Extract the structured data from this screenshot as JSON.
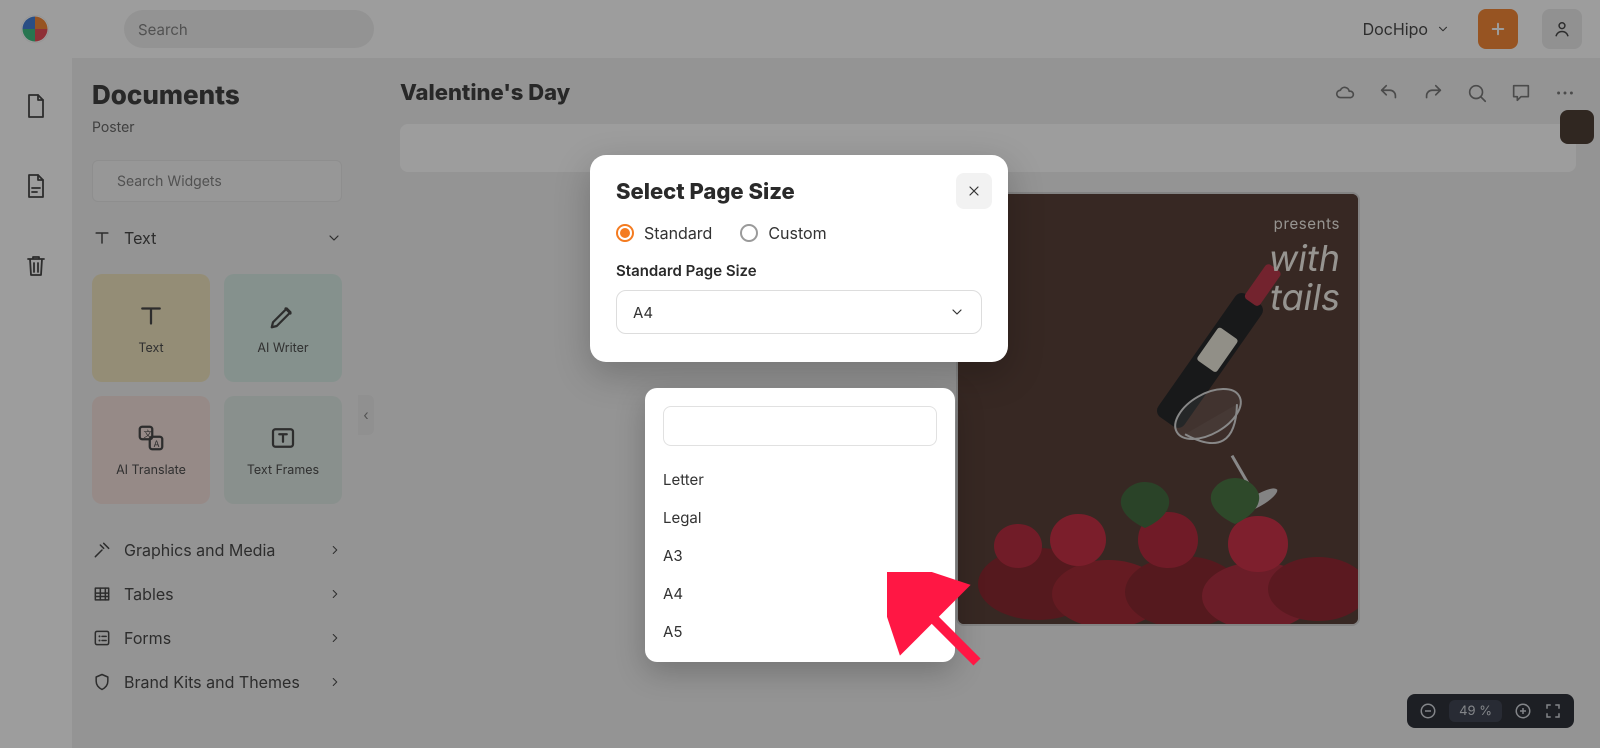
{
  "topbar": {
    "search_placeholder": "Search",
    "workspace": "DocHipo"
  },
  "sidebar": {
    "title": "Documents",
    "subtitle": "Poster",
    "search_widgets_placeholder": "Search Widgets",
    "group_text": "Text",
    "cards": {
      "text": "Text",
      "ai_writer": "AI Writer",
      "ai_translate": "AI Translate",
      "text_frames": "Text Frames"
    },
    "menu": {
      "graphics": "Graphics and Media",
      "tables": "Tables",
      "forms": "Forms",
      "brand": "Brand Kits and Themes"
    }
  },
  "canvas": {
    "title": "Valentine's Day",
    "zoom": "49 %"
  },
  "poster": {
    "presents": "presents",
    "line1": "with",
    "line2": "tails"
  },
  "modal": {
    "title": "Select Page Size",
    "radio_standard": "Standard",
    "radio_custom": "Custom",
    "label_standard": "Standard Page Size",
    "selected_value": "A4"
  },
  "dropdown": {
    "options": [
      "Letter",
      "Legal",
      "A3",
      "A4",
      "A5"
    ],
    "selected": "A4"
  }
}
